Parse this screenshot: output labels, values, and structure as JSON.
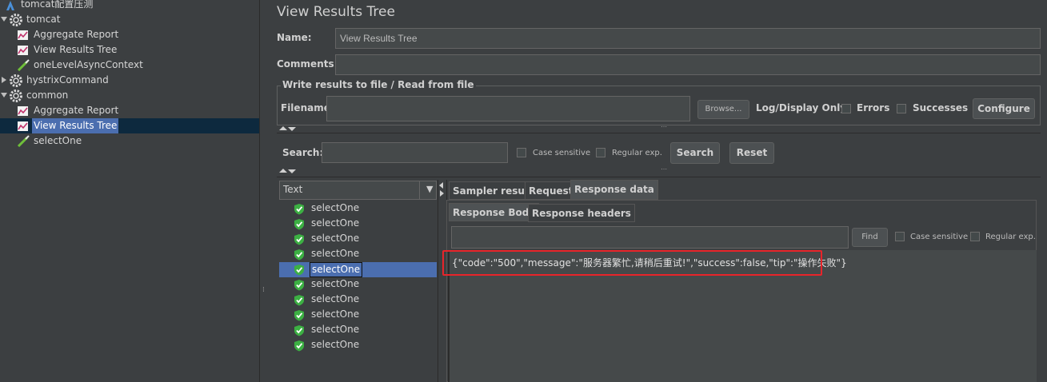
{
  "tree": {
    "items": [
      {
        "label": "tomcat配置压测",
        "level": 0,
        "icon": "testplan-icon"
      },
      {
        "label": "tomcat",
        "level": 0,
        "icon": "gear-icon",
        "expanded": true
      },
      {
        "label": "Aggregate Report",
        "level": 1,
        "icon": "report-icon"
      },
      {
        "label": "View Results Tree",
        "level": 1,
        "icon": "report-icon"
      },
      {
        "label": "oneLevelAsyncContext",
        "level": 1,
        "icon": "sampler-icon"
      },
      {
        "label": "hystrixCommand",
        "level": 0,
        "icon": "gear-icon",
        "expanded": false
      },
      {
        "label": "common",
        "level": 0,
        "icon": "gear-icon",
        "expanded": true
      },
      {
        "label": "Aggregate Report",
        "level": 1,
        "icon": "report-icon"
      },
      {
        "label": "View Results Tree",
        "level": 1,
        "icon": "report-icon",
        "selected": true
      },
      {
        "label": "selectOne",
        "level": 1,
        "icon": "sampler-icon"
      }
    ]
  },
  "panel": {
    "title": "View Results Tree",
    "name_label": "Name:",
    "name_value": "View Results Tree",
    "comments_label": "Comments:",
    "comments_value": "",
    "write_legend": "Write results to file / Read from file",
    "filename_label": "Filename",
    "filename_value": "",
    "browse_label": "Browse...",
    "logdisplay_label": "Log/Display Only:",
    "errors_label": "Errors",
    "successes_label": "Successes",
    "configure_label": "Configure"
  },
  "search": {
    "label": "Search:",
    "value": "",
    "case_label": "Case sensitive",
    "regex_label": "Regular exp.",
    "search_button": "Search",
    "reset_button": "Reset"
  },
  "results": {
    "renderer": "Text",
    "items": [
      "selectOne",
      "selectOne",
      "selectOne",
      "selectOne",
      "selectOne",
      "selectOne",
      "selectOne",
      "selectOne",
      "selectOne",
      "selectOne"
    ],
    "selected_index": 4
  },
  "tabs": {
    "main": [
      "Sampler result",
      "Request",
      "Response data"
    ],
    "main_active": 2,
    "sub": [
      "Response Body",
      "Response headers"
    ],
    "sub_active": 0
  },
  "find": {
    "value": "",
    "button": "Find",
    "case_label": "Case sensitive",
    "regex_label": "Regular exp."
  },
  "response": {
    "body": "{\"code\":\"500\",\"message\":\"服务器繁忙,请稍后重试!\",\"success\":false,\"tip\":\"操作失败\"}"
  },
  "colors": {
    "background": "#3c3f41",
    "selection": "#4b6eaf",
    "highlight_box": "#e8242a",
    "success_icon": "#3cb043"
  }
}
